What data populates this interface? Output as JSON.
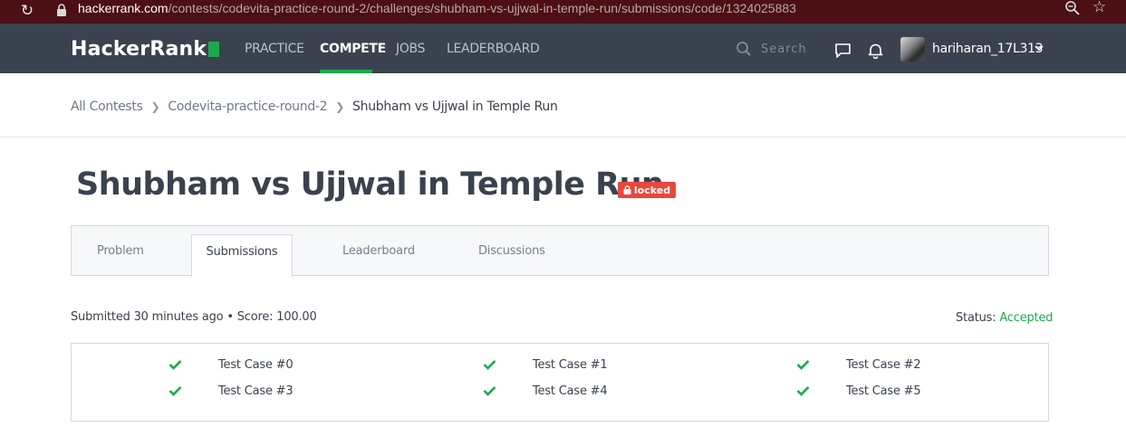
{
  "browser": {
    "url_host": "hackerrank.com",
    "url_path": "/contests/codevita-practice-round-2/challenges/shubham-vs-ujjwal-in-temple-run/submissions/code/1324025883"
  },
  "nav": {
    "logo": "HackerRank",
    "items": [
      "PRACTICE",
      "COMPETE",
      "JOBS",
      "LEADERBOARD"
    ],
    "active_item": "COMPETE",
    "search_placeholder": "Search",
    "username": "hariharan_17L313"
  },
  "breadcrumb": {
    "items": [
      "All Contests",
      "Codevita-practice-round-2"
    ],
    "current": "Shubham vs Ujjwal in Temple Run"
  },
  "challenge": {
    "title": "Shubham vs Ujjwal in Temple Run",
    "badge": "locked"
  },
  "tabs": [
    "Problem",
    "Submissions",
    "Leaderboard",
    "Discussions"
  ],
  "active_tab": "Submissions",
  "submission": {
    "info": "Submitted 30 minutes ago • Score: 100.00",
    "status_label": "Status:",
    "status_value": "Accepted"
  },
  "test_cases": [
    "Test Case #0",
    "Test Case #1",
    "Test Case #2",
    "Test Case #3",
    "Test Case #4",
    "Test Case #5"
  ],
  "colors": {
    "nav_bg": "#39424e",
    "accent_green": "#1ba94c",
    "badge_red": "#e8473c",
    "url_bar_bg": "#4b0f14"
  }
}
